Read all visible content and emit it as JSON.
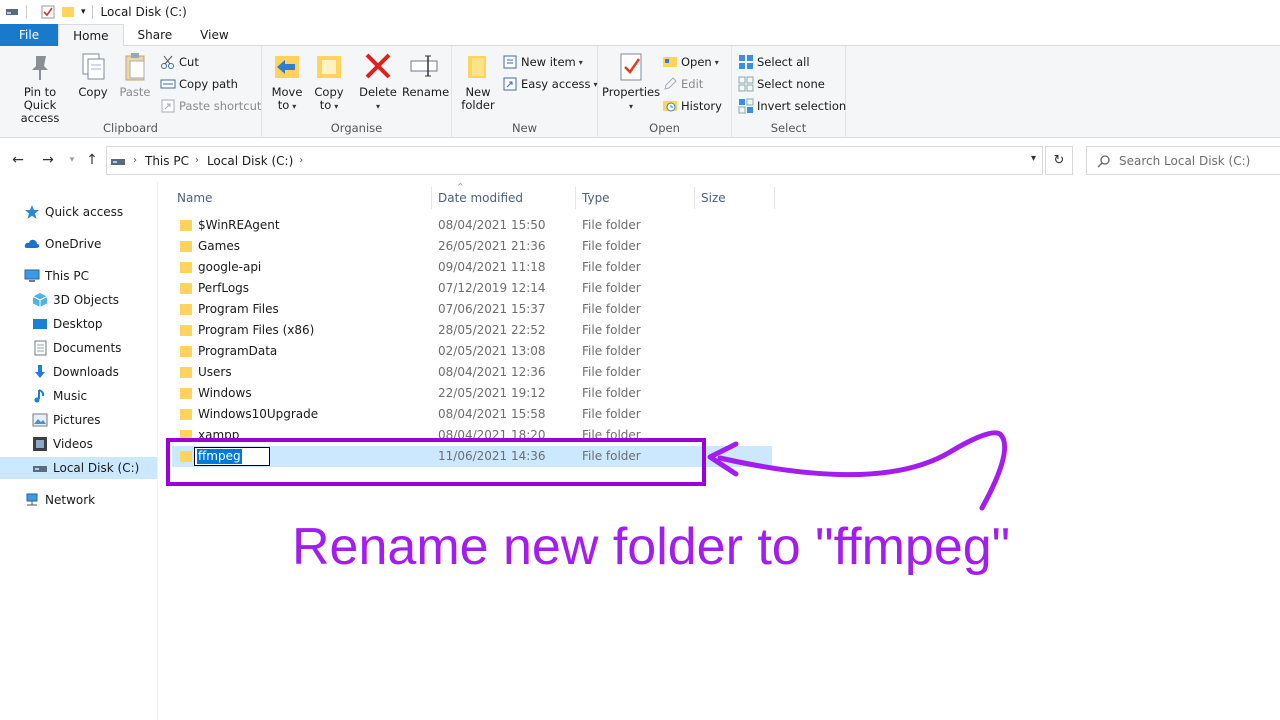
{
  "window": {
    "title": "Local Disk (C:)"
  },
  "ribbon_tabs": [
    "File",
    "Home",
    "Share",
    "View"
  ],
  "ribbon": {
    "clipboard": {
      "label": "Clipboard",
      "pin": "Pin to Quick access",
      "pin_line1": "Pin to Quick",
      "pin_line2": "access",
      "copy": "Copy",
      "paste": "Paste",
      "cut": "Cut",
      "copy_path": "Copy path",
      "paste_shortcut": "Paste shortcut"
    },
    "organise": {
      "label": "Organise",
      "move_to_line1": "Move",
      "move_to_line2": "to",
      "copy_to_line1": "Copy",
      "copy_to_line2": "to",
      "delete": "Delete",
      "rename": "Rename"
    },
    "new": {
      "label": "New",
      "new_folder_line1": "New",
      "new_folder_line2": "folder",
      "new_item": "New item",
      "easy_access": "Easy access"
    },
    "open": {
      "label": "Open",
      "properties": "Properties",
      "open": "Open",
      "edit": "Edit",
      "history": "History"
    },
    "select": {
      "label": "Select",
      "select_all": "Select all",
      "select_none": "Select none",
      "invert_selection": "Invert selection"
    }
  },
  "address": {
    "crumbs": [
      "This PC",
      "Local Disk (C:)"
    ]
  },
  "search": {
    "placeholder": "Search Local Disk (C:)"
  },
  "sidebar": {
    "items": [
      {
        "label": "Quick access",
        "icon": "star-icon"
      },
      {
        "label": "OneDrive",
        "icon": "cloud-icon"
      },
      {
        "label": "This PC",
        "icon": "computer-icon"
      },
      {
        "label": "3D Objects",
        "icon": "cube-icon"
      },
      {
        "label": "Desktop",
        "icon": "desktop-icon"
      },
      {
        "label": "Documents",
        "icon": "document-icon"
      },
      {
        "label": "Downloads",
        "icon": "download-icon"
      },
      {
        "label": "Music",
        "icon": "music-icon"
      },
      {
        "label": "Pictures",
        "icon": "pictures-icon"
      },
      {
        "label": "Videos",
        "icon": "film-icon"
      },
      {
        "label": "Local Disk (C:)",
        "icon": "drive-icon"
      },
      {
        "label": "Network",
        "icon": "network-icon"
      }
    ]
  },
  "columns": {
    "name": "Name",
    "date": "Date modified",
    "type": "Type",
    "size": "Size"
  },
  "files": [
    {
      "name": "$WinREAgent",
      "date": "08/04/2021 15:50",
      "type": "File folder"
    },
    {
      "name": "Games",
      "date": "26/05/2021 21:36",
      "type": "File folder"
    },
    {
      "name": "google-api",
      "date": "09/04/2021 11:18",
      "type": "File folder"
    },
    {
      "name": "PerfLogs",
      "date": "07/12/2019 12:14",
      "type": "File folder"
    },
    {
      "name": "Program Files",
      "date": "07/06/2021 15:37",
      "type": "File folder"
    },
    {
      "name": "Program Files (x86)",
      "date": "28/05/2021 22:52",
      "type": "File folder"
    },
    {
      "name": "ProgramData",
      "date": "02/05/2021 13:08",
      "type": "File folder"
    },
    {
      "name": "Users",
      "date": "08/04/2021 12:36",
      "type": "File folder"
    },
    {
      "name": "Windows",
      "date": "22/05/2021 19:12",
      "type": "File folder"
    },
    {
      "name": "Windows10Upgrade",
      "date": "08/04/2021 15:58",
      "type": "File folder"
    },
    {
      "name": "xampp",
      "date": "08/04/2021 18:20",
      "type": "File folder"
    }
  ],
  "renaming_row": {
    "value": "ffmpeg",
    "date": "11/06/2021 14:36",
    "type": "File folder"
  },
  "annotation": {
    "text": "Rename new folder to \"ffmpeg\"",
    "color": "#a31cf0"
  }
}
